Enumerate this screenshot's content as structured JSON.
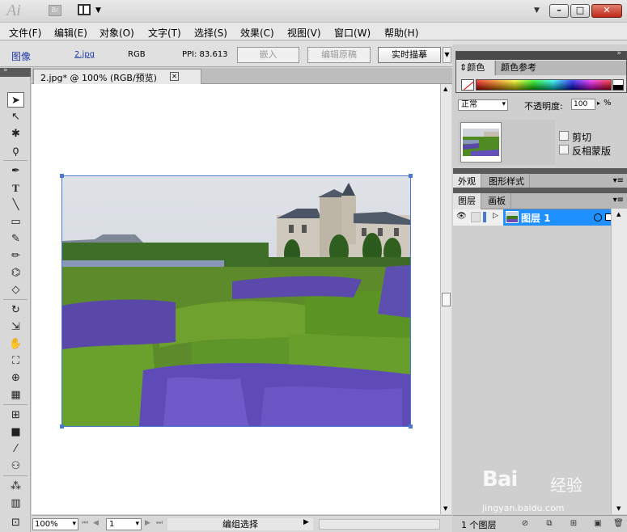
{
  "app": {
    "logo": "Ai",
    "bridge": "Br"
  },
  "menu": [
    "文件(F)",
    "编辑(E)",
    "对象(O)",
    "文字(T)",
    "选择(S)",
    "效果(C)",
    "视图(V)",
    "窗口(W)",
    "帮助(H)"
  ],
  "control": {
    "type_label": "图像",
    "filename": "2.jpg",
    "color_mode": "RGB",
    "ppi": "PPI: 83.613",
    "embed": "嵌入",
    "edit_original": "编辑原稿",
    "live_trace": "实时描摹"
  },
  "document": {
    "tab_label": "2.jpg* @ 100% (RGB/预览)",
    "close_glyph": "✕"
  },
  "status": {
    "zoom": "100%",
    "page": "1",
    "text": "编组选择"
  },
  "color_panel": {
    "tab_color": "颜色",
    "tab_guide": "颜色参考"
  },
  "transparency": {
    "blend": "正常",
    "opacity_label": "不透明度:",
    "opacity_value": "100",
    "pct": "%",
    "clip": "剪切",
    "invert_mask": "反相蒙版"
  },
  "appearance_tabs": {
    "appearance": "外观",
    "graphic_styles": "图形样式"
  },
  "layers_tabs": {
    "layers": "图层",
    "artboards": "画板"
  },
  "layers": [
    {
      "name": "图层 1"
    }
  ],
  "layers_footer": {
    "count": "1 个图层"
  },
  "watermark": {
    "brand": "Bai",
    "brand2": "经验",
    "url": "jingyan.baidu.com"
  },
  "colors": {
    "accent": "#1e90ff",
    "selection": "#4a7ad0",
    "close": "#c02818"
  }
}
